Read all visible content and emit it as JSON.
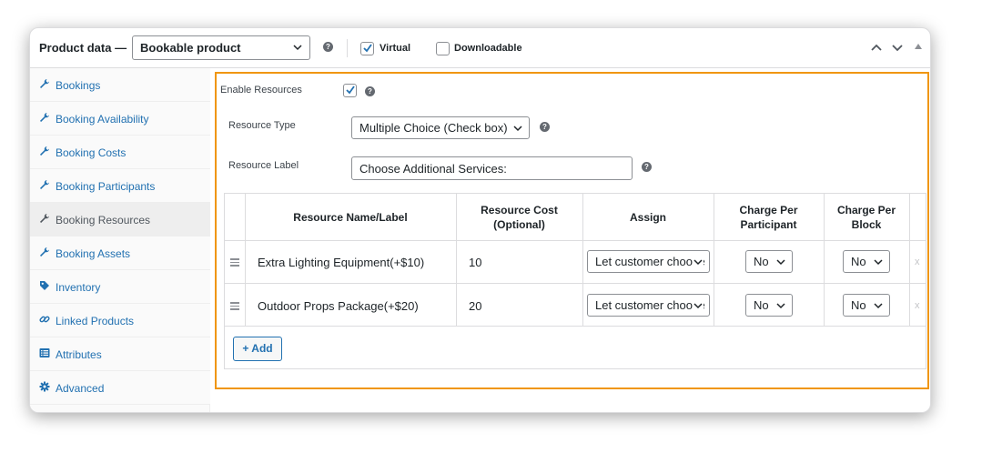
{
  "header": {
    "title": "Product data —",
    "product_type": "Bookable product",
    "virtual_label": "Virtual",
    "virtual_checked": true,
    "downloadable_label": "Downloadable",
    "downloadable_checked": false
  },
  "sidebar": {
    "items": [
      {
        "label": "Bookings",
        "icon": "wrench-icon"
      },
      {
        "label": "Booking Availability",
        "icon": "wrench-icon"
      },
      {
        "label": "Booking Costs",
        "icon": "wrench-icon"
      },
      {
        "label": "Booking Participants",
        "icon": "wrench-icon"
      },
      {
        "label": "Booking Resources",
        "icon": "wrench-icon",
        "active": true
      },
      {
        "label": "Booking Assets",
        "icon": "wrench-icon"
      },
      {
        "label": "Inventory",
        "icon": "tag-icon"
      },
      {
        "label": "Linked Products",
        "icon": "link-icon"
      },
      {
        "label": "Attributes",
        "icon": "list-icon"
      },
      {
        "label": "Advanced",
        "icon": "gear-icon"
      }
    ]
  },
  "resources": {
    "enable_label": "Enable Resources",
    "enable_checked": true,
    "type_label": "Resource Type",
    "type_value": "Multiple Choice (Check box)",
    "label_label": "Resource Label",
    "label_value": "Choose Additional Services:"
  },
  "table": {
    "headers": {
      "name": "Resource Name/Label",
      "cost_line1": "Resource Cost",
      "cost_line2": "(Optional)",
      "assign": "Assign",
      "participant_line1": "Charge Per",
      "participant_line2": "Participant",
      "block_line1": "Charge Per",
      "block_line2": "Block"
    },
    "rows": [
      {
        "name": "Extra Lighting Equipment(+$10)",
        "cost": "10",
        "assign": "Let customer choose",
        "per_participant": "No",
        "per_block": "No",
        "remove": "x"
      },
      {
        "name": "Outdoor Props Package(+$20)",
        "cost": "20",
        "assign": "Let customer choose",
        "per_participant": "No",
        "per_block": "No",
        "remove": "x"
      }
    ],
    "add_label": "+ Add"
  },
  "colors": {
    "accent": "#2271b1",
    "highlight_border": "#f0960e",
    "active_bg": "#eeeeee"
  }
}
